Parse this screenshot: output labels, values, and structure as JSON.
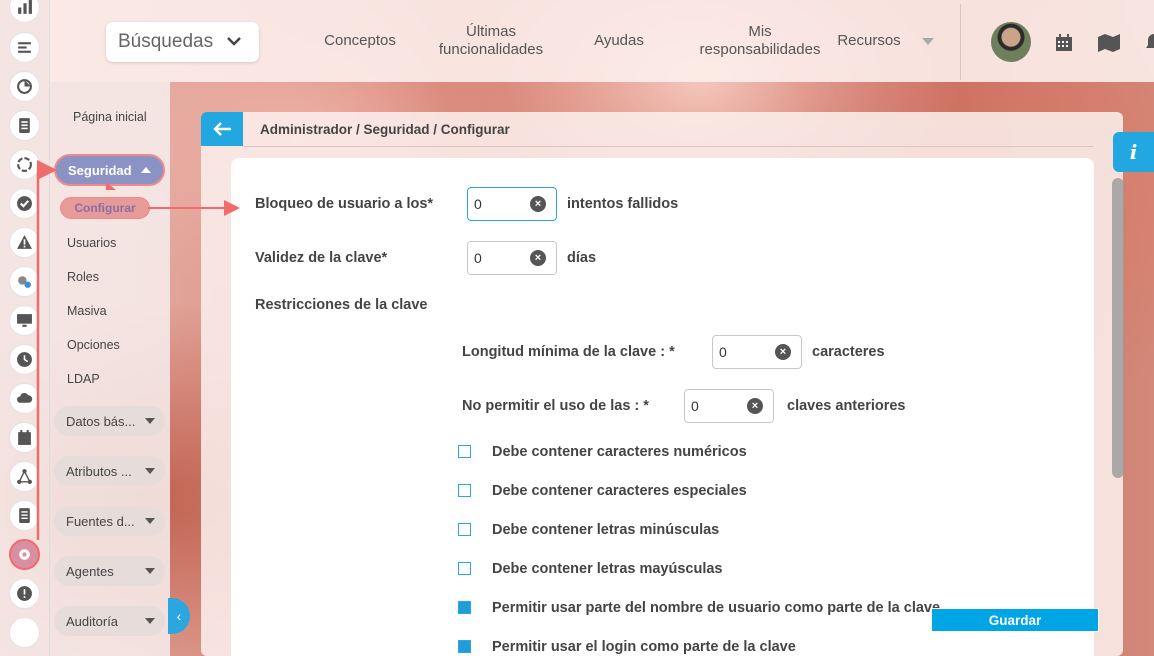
{
  "header": {
    "search_label": "Búsquedas",
    "nav": [
      "Conceptos",
      "Últimas funcionalidades",
      "Ayudas",
      "Mis responsabilidades",
      "Recursos"
    ]
  },
  "sidebar": {
    "home": "Página inicial",
    "security": "Seguridad",
    "configure": "Configurar",
    "items": [
      "Usuarios",
      "Roles",
      "Masiva",
      "Opciones",
      "LDAP"
    ],
    "groups": [
      "Datos bás...",
      "Atributos ...",
      "Fuentes d...",
      "Agentes",
      "Auditoría"
    ]
  },
  "page": {
    "breadcrumb": "Administrador / Seguridad / Configurar",
    "block_label": "Bloqueo de usuario a los*",
    "block_value": "0",
    "block_unit": "intentos fallidos",
    "validity_label": "Validez de la clave*",
    "validity_value": "0",
    "validity_unit": "días",
    "restrictions_title": "Restricciones de la clave",
    "minlen_label": "Longitud mínima de la clave : *",
    "minlen_value": "0",
    "minlen_unit": "caracteres",
    "history_label": "No permitir el uso de las : *",
    "history_value": "0",
    "history_unit": "claves anteriores",
    "checks": [
      {
        "label": "Debe contener caracteres numéricos",
        "checked": false
      },
      {
        "label": "Debe contener caracteres especiales",
        "checked": false
      },
      {
        "label": "Debe contener letras minúsculas",
        "checked": false
      },
      {
        "label": "Debe contener letras mayúsculas",
        "checked": false
      },
      {
        "label": "Permitir usar parte del nombre de usuario como parte de la clave",
        "checked": true
      },
      {
        "label": "Permitir usar el login como parte de la clave",
        "checked": true
      }
    ],
    "save": "Guardar",
    "info": "i"
  },
  "colors": {
    "accent": "#22a7e0",
    "annotation": "#f06b6b"
  }
}
